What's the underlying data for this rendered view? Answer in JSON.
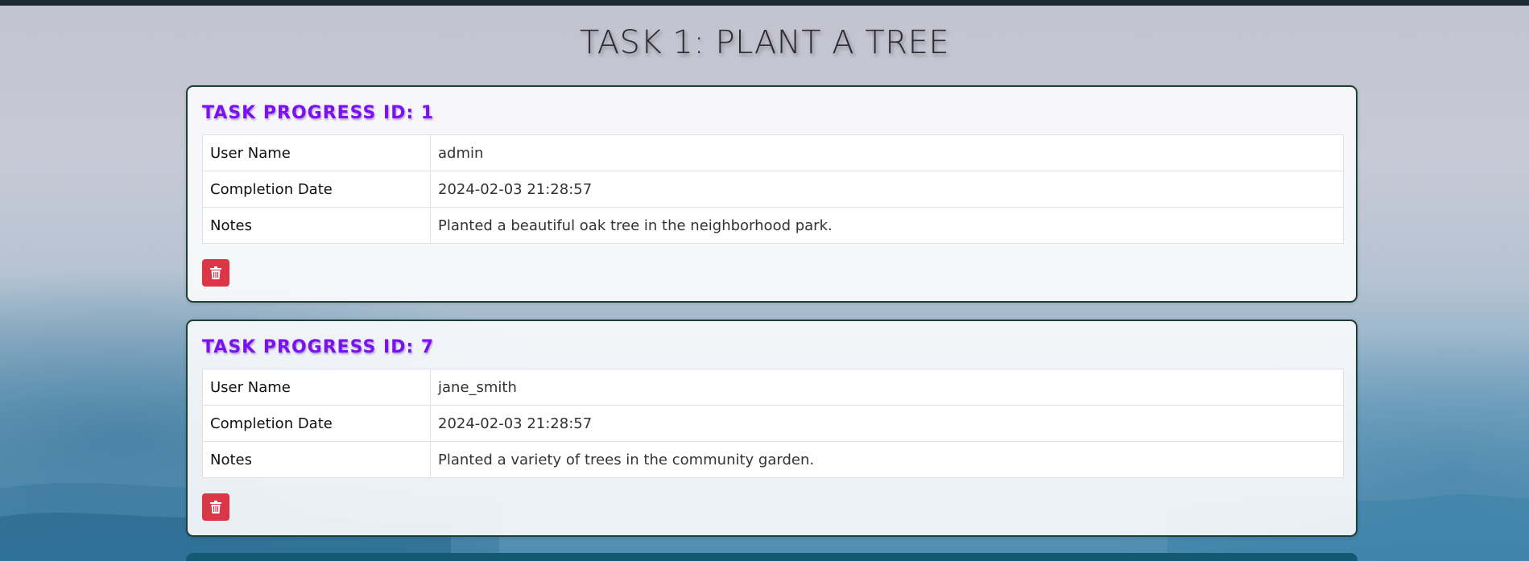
{
  "page": {
    "title": "TASK 1: PLANT A TREE"
  },
  "colors": {
    "heading": "#7a12ee",
    "delete_button": "#dc3545",
    "card_border": "#1e3f33",
    "top_bar": "#1f2a38"
  },
  "progress_entries": [
    {
      "heading": "TASK PROGRESS ID: 1",
      "rows": [
        {
          "key": "User Name",
          "value": "admin"
        },
        {
          "key": "Completion Date",
          "value": "2024-02-03 21:28:57"
        },
        {
          "key": "Notes",
          "value": "Planted a beautiful oak tree in the neighborhood park."
        }
      ],
      "delete_icon": "trash-icon"
    },
    {
      "heading": "TASK PROGRESS ID: 7",
      "rows": [
        {
          "key": "User Name",
          "value": "jane_smith"
        },
        {
          "key": "Completion Date",
          "value": "2024-02-03 21:28:57"
        },
        {
          "key": "Notes",
          "value": "Planted a variety of trees in the community garden."
        }
      ],
      "delete_icon": "trash-icon"
    }
  ]
}
